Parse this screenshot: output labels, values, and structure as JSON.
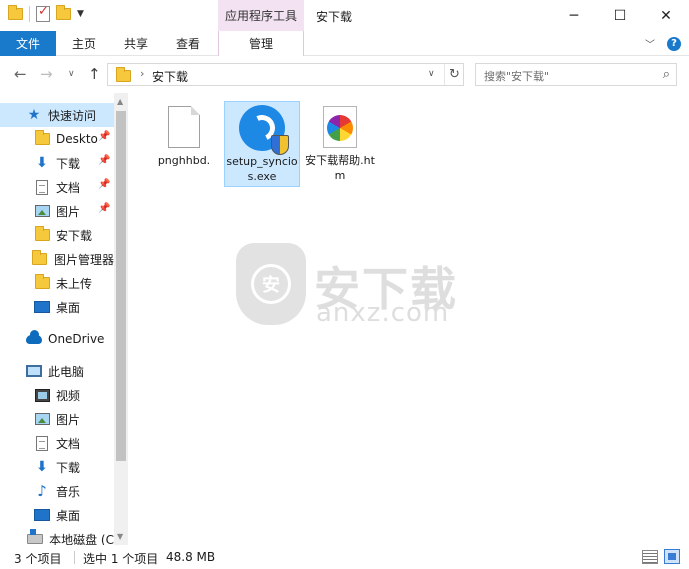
{
  "window": {
    "title": "安下载",
    "context_tab": "应用程序工具",
    "minimize": "─",
    "maximize": "☐",
    "close": "✕"
  },
  "ribbon": {
    "tabs": [
      "文件",
      "主页",
      "共享",
      "查看",
      "管理"
    ],
    "help": "?"
  },
  "address": {
    "path": "安下载",
    "search_placeholder": "搜索\"安下载\""
  },
  "nav": {
    "items": [
      {
        "label": "快速访问",
        "icon": "star-icon"
      },
      {
        "label": "Deskto",
        "icon": "folder-icon"
      },
      {
        "label": "下载",
        "icon": "download-icon"
      },
      {
        "label": "文档",
        "icon": "document-icon"
      },
      {
        "label": "图片",
        "icon": "picture-icon"
      },
      {
        "label": "安下载",
        "icon": "folder-icon"
      },
      {
        "label": "图片管理器",
        "icon": "folder-icon"
      },
      {
        "label": "未上传",
        "icon": "folder-icon"
      },
      {
        "label": "桌面",
        "icon": "desktop-icon"
      },
      {
        "label": "OneDrive",
        "icon": "cloud-icon"
      },
      {
        "label": "此电脑",
        "icon": "computer-icon"
      },
      {
        "label": "视频",
        "icon": "video-icon"
      },
      {
        "label": "图片",
        "icon": "picture-icon"
      },
      {
        "label": "文档",
        "icon": "document-icon"
      },
      {
        "label": "下载",
        "icon": "download-icon"
      },
      {
        "label": "音乐",
        "icon": "music-icon"
      },
      {
        "label": "桌面",
        "icon": "desktop-icon"
      },
      {
        "label": "本地磁盘 (C",
        "icon": "disk-icon"
      }
    ]
  },
  "files": [
    {
      "name": "pnghhbd.",
      "icon": "blank-file-icon"
    },
    {
      "name": "setup_syncios.exe",
      "icon": "syncios-app-icon"
    },
    {
      "name": "安下载帮助.htm",
      "icon": "htm-file-icon"
    }
  ],
  "watermark": {
    "cn": "安下载",
    "en": "anxz.com",
    "shield_char": "安"
  },
  "status": {
    "count": "3 个项目",
    "selected": "选中 1 个项目",
    "size": "48.8 MB"
  },
  "colors": {
    "accent": "#1979ca",
    "selection": "#cce8ff",
    "context_tab": "#f3e3f2"
  }
}
